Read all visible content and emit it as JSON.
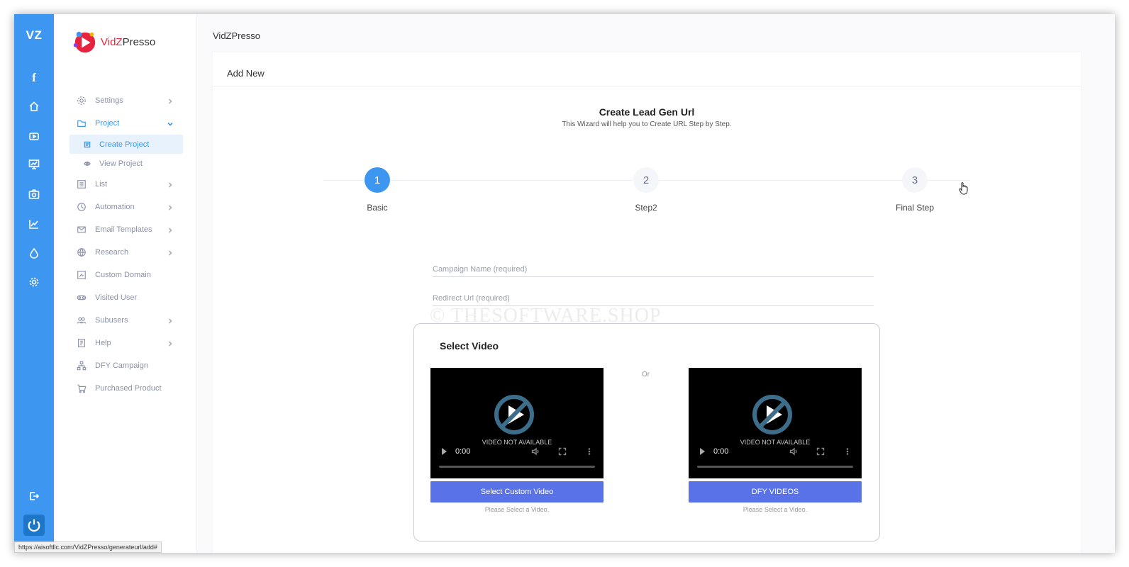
{
  "rail": {
    "logo": "VZ",
    "facebook": "f"
  },
  "brand": {
    "part1": "VidZ",
    "part2": "Presso"
  },
  "menu": {
    "settings": "Settings",
    "project": "Project",
    "create_project": "Create Project",
    "view_project": "View Project",
    "list": "List",
    "automation": "Automation",
    "email_templates": "Email Templates",
    "research": "Research",
    "custom_domain": "Custom Domain",
    "visited_user": "Visited User",
    "subusers": "Subusers",
    "help": "Help",
    "dfy_campaign": "DFY Campaign",
    "purchased_product": "Purchased Product"
  },
  "page": {
    "breadcrumb": "VidZPresso",
    "card_title": "Add New"
  },
  "wizard": {
    "title": "Create Lead Gen Url",
    "subtitle": "This Wizard will help you to Create URL Step by Step.",
    "steps": [
      {
        "num": "1",
        "label": "Basic"
      },
      {
        "num": "2",
        "label": "Step2"
      },
      {
        "num": "3",
        "label": "Final Step"
      }
    ]
  },
  "form": {
    "campaign_placeholder": "Campaign Name (required)",
    "redirect_placeholder": "Redirect Url (required)"
  },
  "watermark": "© THESOFTWARE.SHOP",
  "video": {
    "title": "Select Video",
    "or": "Or",
    "not_available": "VIDEO NOT AVAILABLE",
    "time": "0:00",
    "custom_button": "Select Custom Video",
    "dfy_button": "DFY VIDEOS",
    "hint": "Please Select a Video."
  },
  "status_url": "https://aisoftllc.com/VidZPresso/generateurl/add#",
  "colors": {
    "primary": "#3d97f0",
    "button": "#5a72e8",
    "brand_red": "#e8233d"
  }
}
